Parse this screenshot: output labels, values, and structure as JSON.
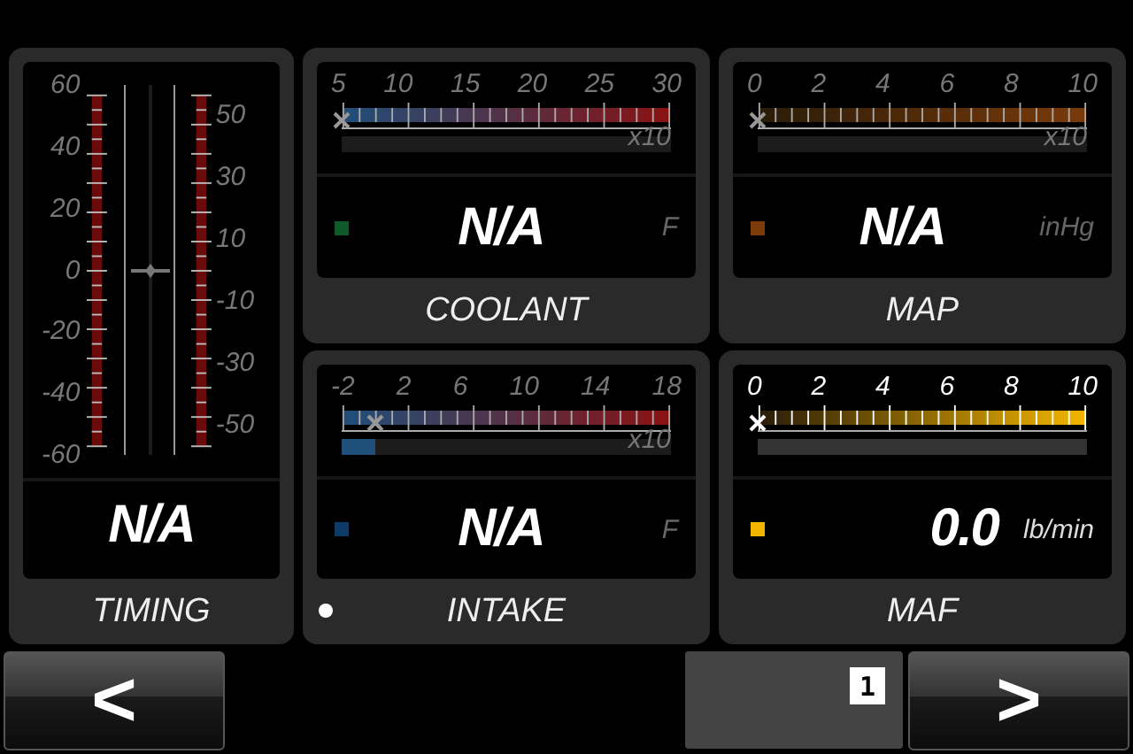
{
  "gauges": [
    {
      "kind": "vertical",
      "label": "TIMING",
      "value": "N/A",
      "left_ticks": [
        "60",
        "40",
        "20",
        "0",
        "-20",
        "-40",
        "-60"
      ],
      "right_ticks": [
        "50",
        "30",
        "10",
        "-10",
        "-30",
        "-50"
      ],
      "level": 0.5,
      "selected": false
    },
    {
      "kind": "horizontal",
      "label": "COOLANT",
      "value": "N/A",
      "unit": "F",
      "ticks": [
        "5",
        "10",
        "15",
        "20",
        "25",
        "30"
      ],
      "multiplier": "x10",
      "color": "#0d5a2a",
      "cold_hot": true,
      "level": 0,
      "selected": false,
      "active": false
    },
    {
      "kind": "horizontal",
      "label": "MAP",
      "value": "N/A",
      "unit": "inHg",
      "ticks": [
        "0",
        "2",
        "4",
        "6",
        "8",
        "10"
      ],
      "multiplier": "x10",
      "color": "#7a3a0a",
      "cold_hot": false,
      "level": 0,
      "selected": false,
      "active": false
    },
    {
      "kind": "horizontal",
      "label": "INTAKE",
      "value": "N/A",
      "unit": "F",
      "ticks": [
        "-2",
        "2",
        "6",
        "10",
        "14",
        "18"
      ],
      "multiplier": "x10",
      "color": "#0d3a66",
      "cold_hot": true,
      "level": 0.1,
      "selected": true,
      "active": false
    },
    {
      "kind": "horizontal",
      "label": "MAF",
      "value": "0.0",
      "unit": "lb/min",
      "ticks": [
        "0",
        "2",
        "4",
        "6",
        "8",
        "10"
      ],
      "color": "#f2b600",
      "cold_hot": false,
      "level": 0,
      "selected": false,
      "active": true
    }
  ],
  "nav": {
    "prev": "<",
    "page": "1",
    "next": ">"
  }
}
